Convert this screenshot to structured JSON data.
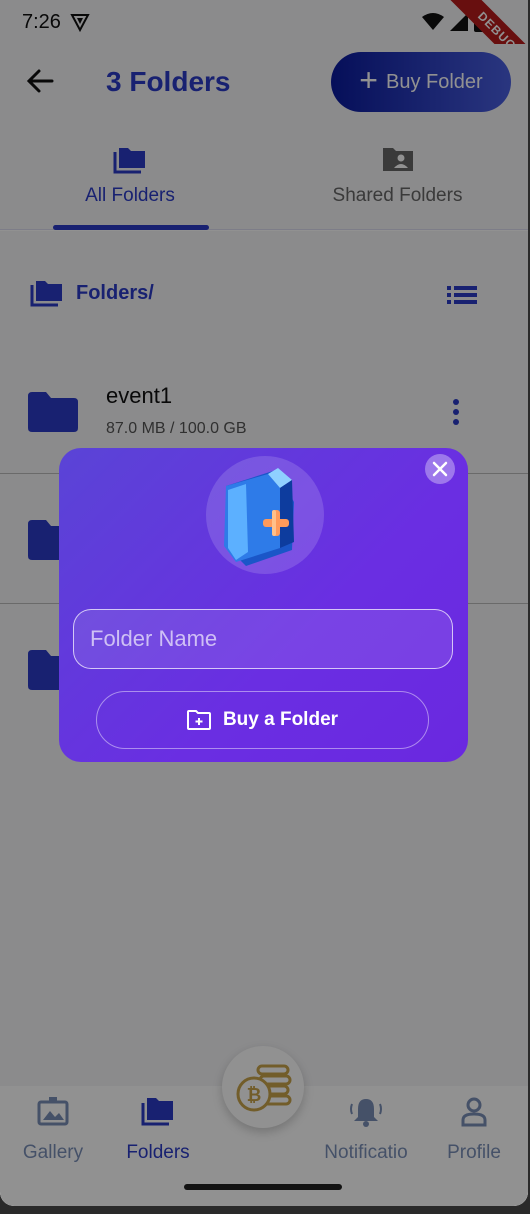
{
  "status": {
    "time": "7:26",
    "debug_label": "DEBUG"
  },
  "appbar": {
    "title": "3 Folders",
    "buy_label": "Buy Folder"
  },
  "tabs": [
    {
      "label": "All Folders"
    },
    {
      "label": "Shared Folders"
    }
  ],
  "path": {
    "label": "Folders/"
  },
  "folders": [
    {
      "name": "event1",
      "size": "87.0 MB / 100.0 GB"
    }
  ],
  "dialog": {
    "placeholder": "Folder Name",
    "button_label": "Buy a Folder"
  },
  "bottom_nav": [
    {
      "label": "Gallery",
      "icon": "gallery-icon"
    },
    {
      "label": "Folders",
      "icon": "folders-icon"
    },
    {
      "label": "Notificatio",
      "icon": "bell-icon"
    },
    {
      "label": "Profile",
      "icon": "profile-icon"
    }
  ],
  "colors": {
    "primary": "#2b3bc7",
    "dialog_start": "#5a44d6",
    "dialog_end": "#6a28e0",
    "debug": "#b71c1c"
  }
}
